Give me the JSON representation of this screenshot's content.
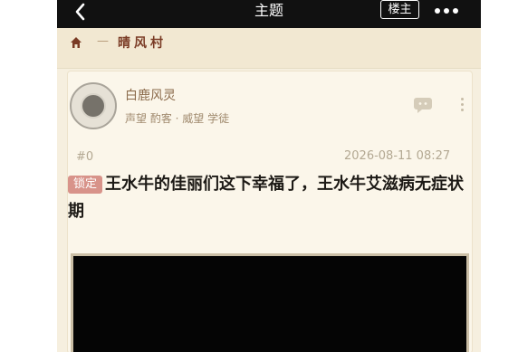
{
  "topbar": {
    "title": "主题",
    "owner_label": "楼主",
    "back_icon": "chevron-left-icon",
    "more_icon": "more-dots-icon"
  },
  "breadcrumb": {
    "home_icon": "home-icon",
    "separator": "—",
    "forum": "晴风村"
  },
  "post": {
    "author": "白鹿风灵",
    "author_meta": "声望 酌客 · 威望 学徒",
    "floor": "#0",
    "timestamp": "2026-08-11 08:27",
    "lock_label": "锁定",
    "title": "王水牛的佳丽们这下幸福了，王水牛艾滋病无症状期",
    "reply_icon": "reply-bubble-icon",
    "menu_icon": "vertical-dots-icon"
  },
  "colors": {
    "topbar": "#111111",
    "background": "#f6efdf",
    "accent": "#7a3b25",
    "badge": "#d8938a"
  }
}
